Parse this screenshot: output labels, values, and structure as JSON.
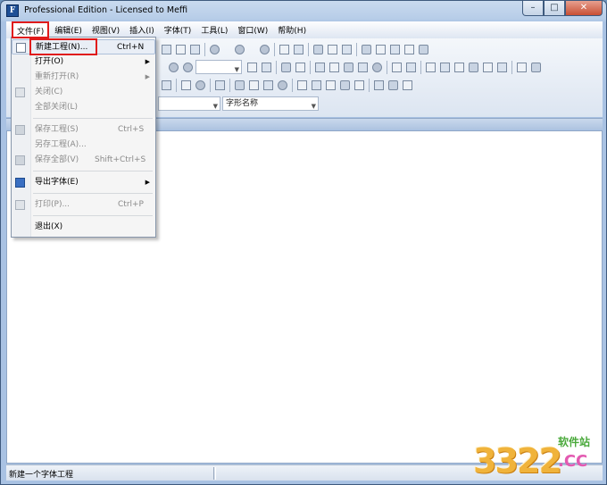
{
  "window": {
    "app_icon_letter": "F",
    "title": "Professional Edition - Licensed to Meffi",
    "minimize": "–",
    "maximize": "□",
    "close": "✕"
  },
  "menubar": {
    "items": [
      {
        "label": "文件(F)",
        "active": true
      },
      {
        "label": "编辑(E)"
      },
      {
        "label": "视图(V)"
      },
      {
        "label": "插入(I)"
      },
      {
        "label": "字体(T)"
      },
      {
        "label": "工具(L)"
      },
      {
        "label": "窗口(W)"
      },
      {
        "label": "帮助(H)"
      }
    ]
  },
  "toolbar": {
    "font_name_combo": "字形名称",
    "zoom_combo": ""
  },
  "file_menu": {
    "items": [
      {
        "label": "新建工程(N)...",
        "shortcut": "Ctrl+N",
        "disabled": false,
        "icon": "new-project-icon"
      },
      {
        "label": "打开(O)",
        "submenu": true,
        "disabled": false
      },
      {
        "label": "重新打开(R)",
        "submenu": true,
        "disabled": true
      },
      {
        "label": "关闭(C)",
        "disabled": true,
        "icon": "close-doc-icon"
      },
      {
        "label": "全部关闭(L)",
        "disabled": true
      },
      {
        "label": "保存工程(S)",
        "shortcut": "Ctrl+S",
        "disabled": true,
        "icon": "save-icon"
      },
      {
        "label": "另存工程(A)...",
        "disabled": true
      },
      {
        "label": "保存全部(V)",
        "shortcut": "Shift+Ctrl+S",
        "disabled": true,
        "icon": "save-all-icon"
      },
      {
        "label": "导出字体(E)",
        "submenu": true,
        "disabled": false,
        "icon": "export-font-icon"
      },
      {
        "label": "打印(P)...",
        "shortcut": "Ctrl+P",
        "disabled": true,
        "icon": "print-icon"
      },
      {
        "label": "退出(X)",
        "disabled": false
      }
    ]
  },
  "statusbar": {
    "text": "新建一个字体工程"
  },
  "watermark": {
    "number": "3322",
    "cn": "软件站",
    "domain": ".CC"
  },
  "colors": {
    "highlight_box": "#e01b1b",
    "title_bar": "#b7cde8"
  }
}
